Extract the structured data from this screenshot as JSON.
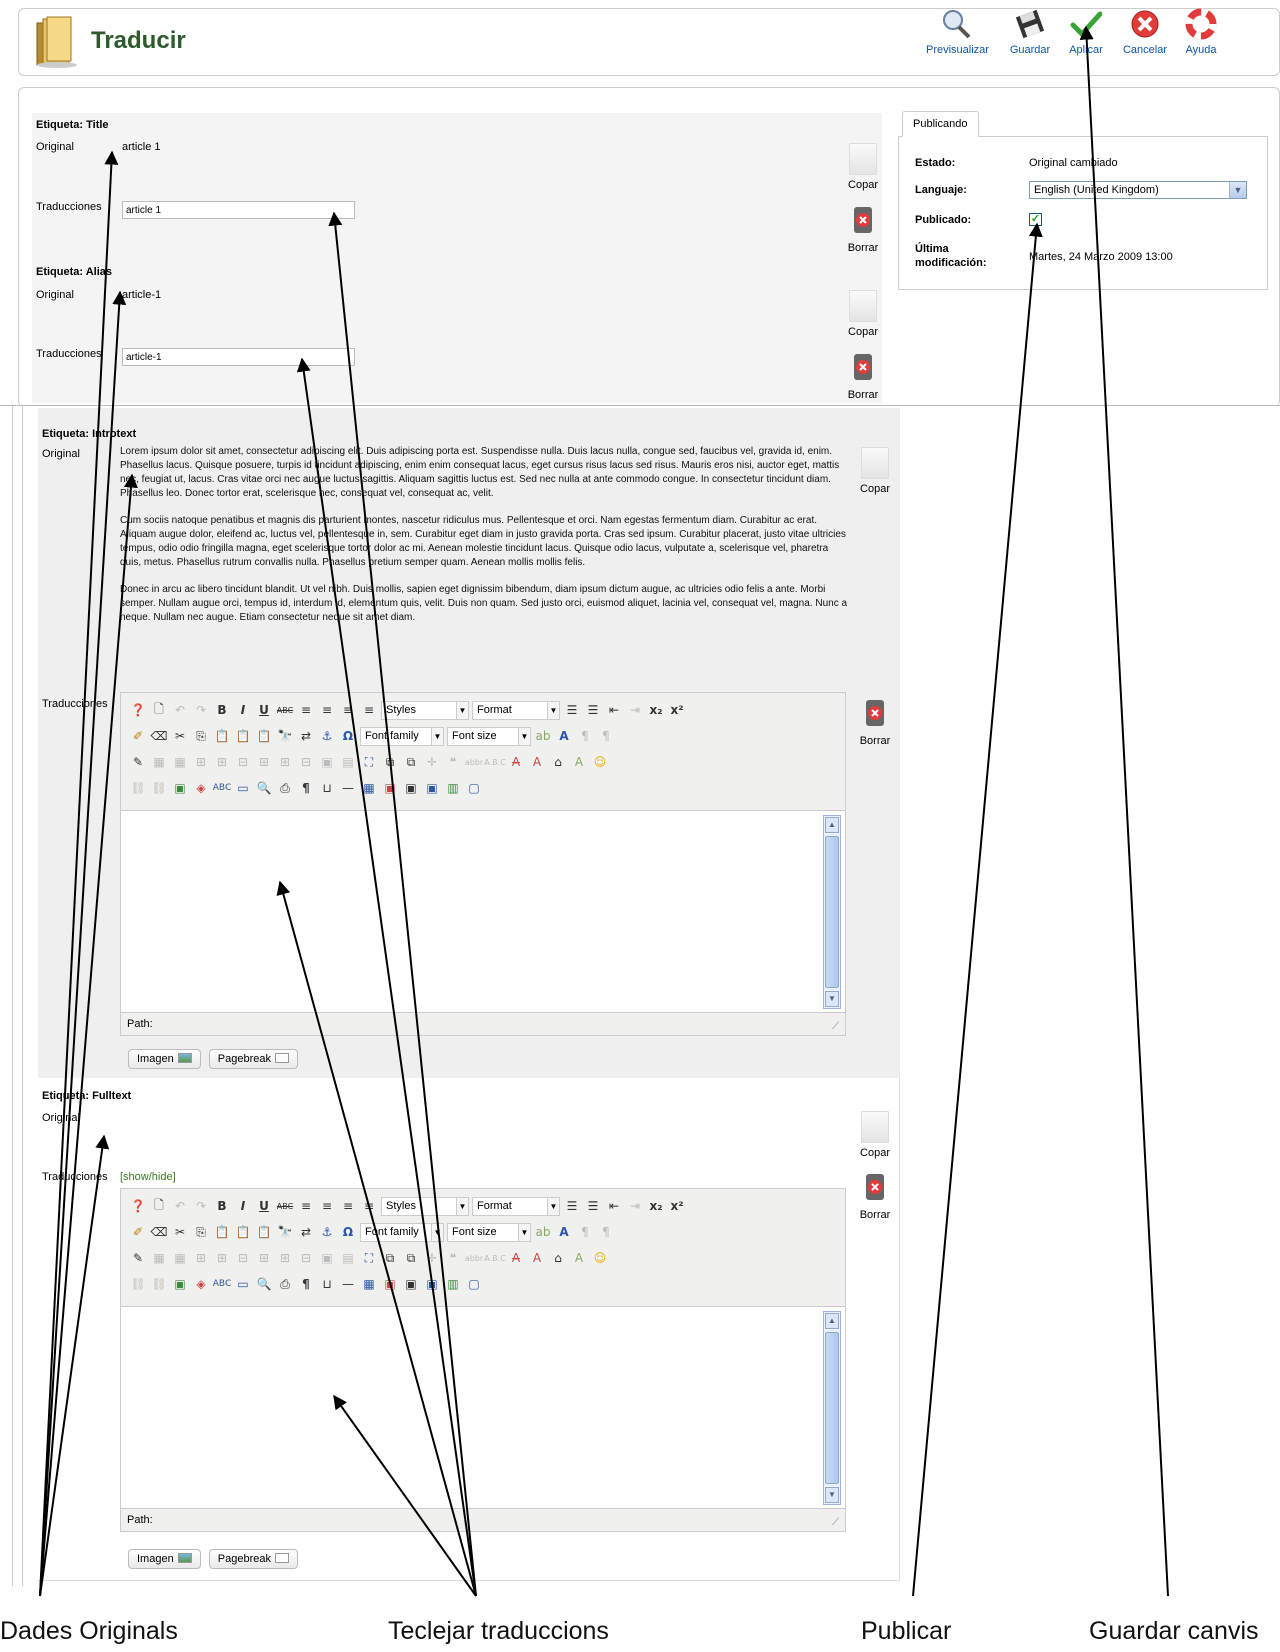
{
  "header": {
    "title": "Traducir",
    "toolbar": [
      {
        "label": "Previsualizar",
        "icon": "magnifier-icon"
      },
      {
        "label": "Guardar",
        "icon": "floppy-disk-icon"
      },
      {
        "label": "Aplicar",
        "icon": "checkmark-icon"
      },
      {
        "label": "Cancelar",
        "icon": "cancel-icon"
      },
      {
        "label": "Ayuda",
        "icon": "lifebuoy-icon"
      }
    ]
  },
  "fields": {
    "title": {
      "label": "Etiqueta: Title",
      "original_label": "Original",
      "original_value": "article 1",
      "translation_label": "Traducciones",
      "translation_value": "article 1"
    },
    "alias": {
      "label": "Etiqueta: Alias",
      "original_label": "Original",
      "original_value": "article-1",
      "translation_label": "Traducciones",
      "translation_value": "article-1"
    },
    "introtext": {
      "label": "Etiqueta: Introtext",
      "original_label": "Original",
      "translation_label": "Traducciones",
      "paragraphs": [
        "Lorem ipsum dolor sit amet, consectetur adipiscing elit. Duis adipiscing porta est. Suspendisse nulla. Duis lacus nulla, congue sed, faucibus vel, gravida id, enim. Phasellus lacus. Quisque posuere, turpis id tincidunt adipiscing, enim enim consequat lacus, eget cursus risus lacus sed risus. Mauris eros nisi, auctor eget, mattis nec, feugiat ut, lacus. Cras vitae orci nec augue luctus sagittis. Aliquam sagittis luctus est. Sed nec nulla at ante commodo congue. In consectetur tincidunt diam. Phasellus leo. Donec tortor erat, scelerisque nec, consequat vel, consequat ac, velit.",
        "Cum sociis natoque penatibus et magnis dis parturient montes, nascetur ridiculus mus. Pellentesque et orci. Nam egestas fermentum diam. Curabitur ac erat. Aliquam augue dolor, eleifend ac, luctus vel, pellentesque in, sem. Curabitur eget diam in justo gravida porta. Cras sed ipsum. Curabitur placerat, justo vitae ultricies tempus, odio odio fringilla magna, eget scelerisque tortor dolor ac mi. Aenean molestie tincidunt lacus. Quisque odio lacus, vulputate a, scelerisque vel, pharetra quis, metus. Phasellus rutrum convallis nulla. Phasellus pretium semper quam. Aenean mollis mollis felis.",
        "Donec in arcu ac libero tincidunt blandit. Ut vel nibh. Duis mollis, sapien eget dignissim bibendum, diam ipsum dictum augue, ac ultricies odio felis a ante. Morbi semper. Nullam augue orci, tempus id, interdum id, elementum quis, velit. Duis non quam. Sed justo orci, euismod aliquet, lacinia vel, consequat vel, magna. Nunc a neque. Nullam nec augue. Etiam consectetur neque sit amet diam."
      ]
    },
    "fulltext": {
      "label": "Etiqueta: Fulltext",
      "original_label": "Original",
      "translation_label": "Traducciones",
      "show_hide": "[show/hide]"
    }
  },
  "actions": {
    "copy": "Copar",
    "delete": "Borrar"
  },
  "editor": {
    "styles": "Styles",
    "format": "Format",
    "font_family": "Font family",
    "font_size": "Font size",
    "path_label": "Path:",
    "image_button": "Imagen",
    "pagebreak_button": "Pagebreak"
  },
  "publishing": {
    "tab": "Publicando",
    "estado_label": "Estado:",
    "estado_value": "Original cambiado",
    "language_label": "Languaje:",
    "language_value": "English (United Kingdom)",
    "published_label": "Publicado:",
    "published_checked": true,
    "last_modified_label_1": "Última",
    "last_modified_label_2": "modificación:",
    "last_modified_value": "Martes, 24 Marzo 2009 13:00"
  },
  "annotations": {
    "original_data": "Dades Originals",
    "type_translations": "Teclejar traduccions",
    "publish": "Publicar",
    "save_changes": "Guardar canvis"
  }
}
